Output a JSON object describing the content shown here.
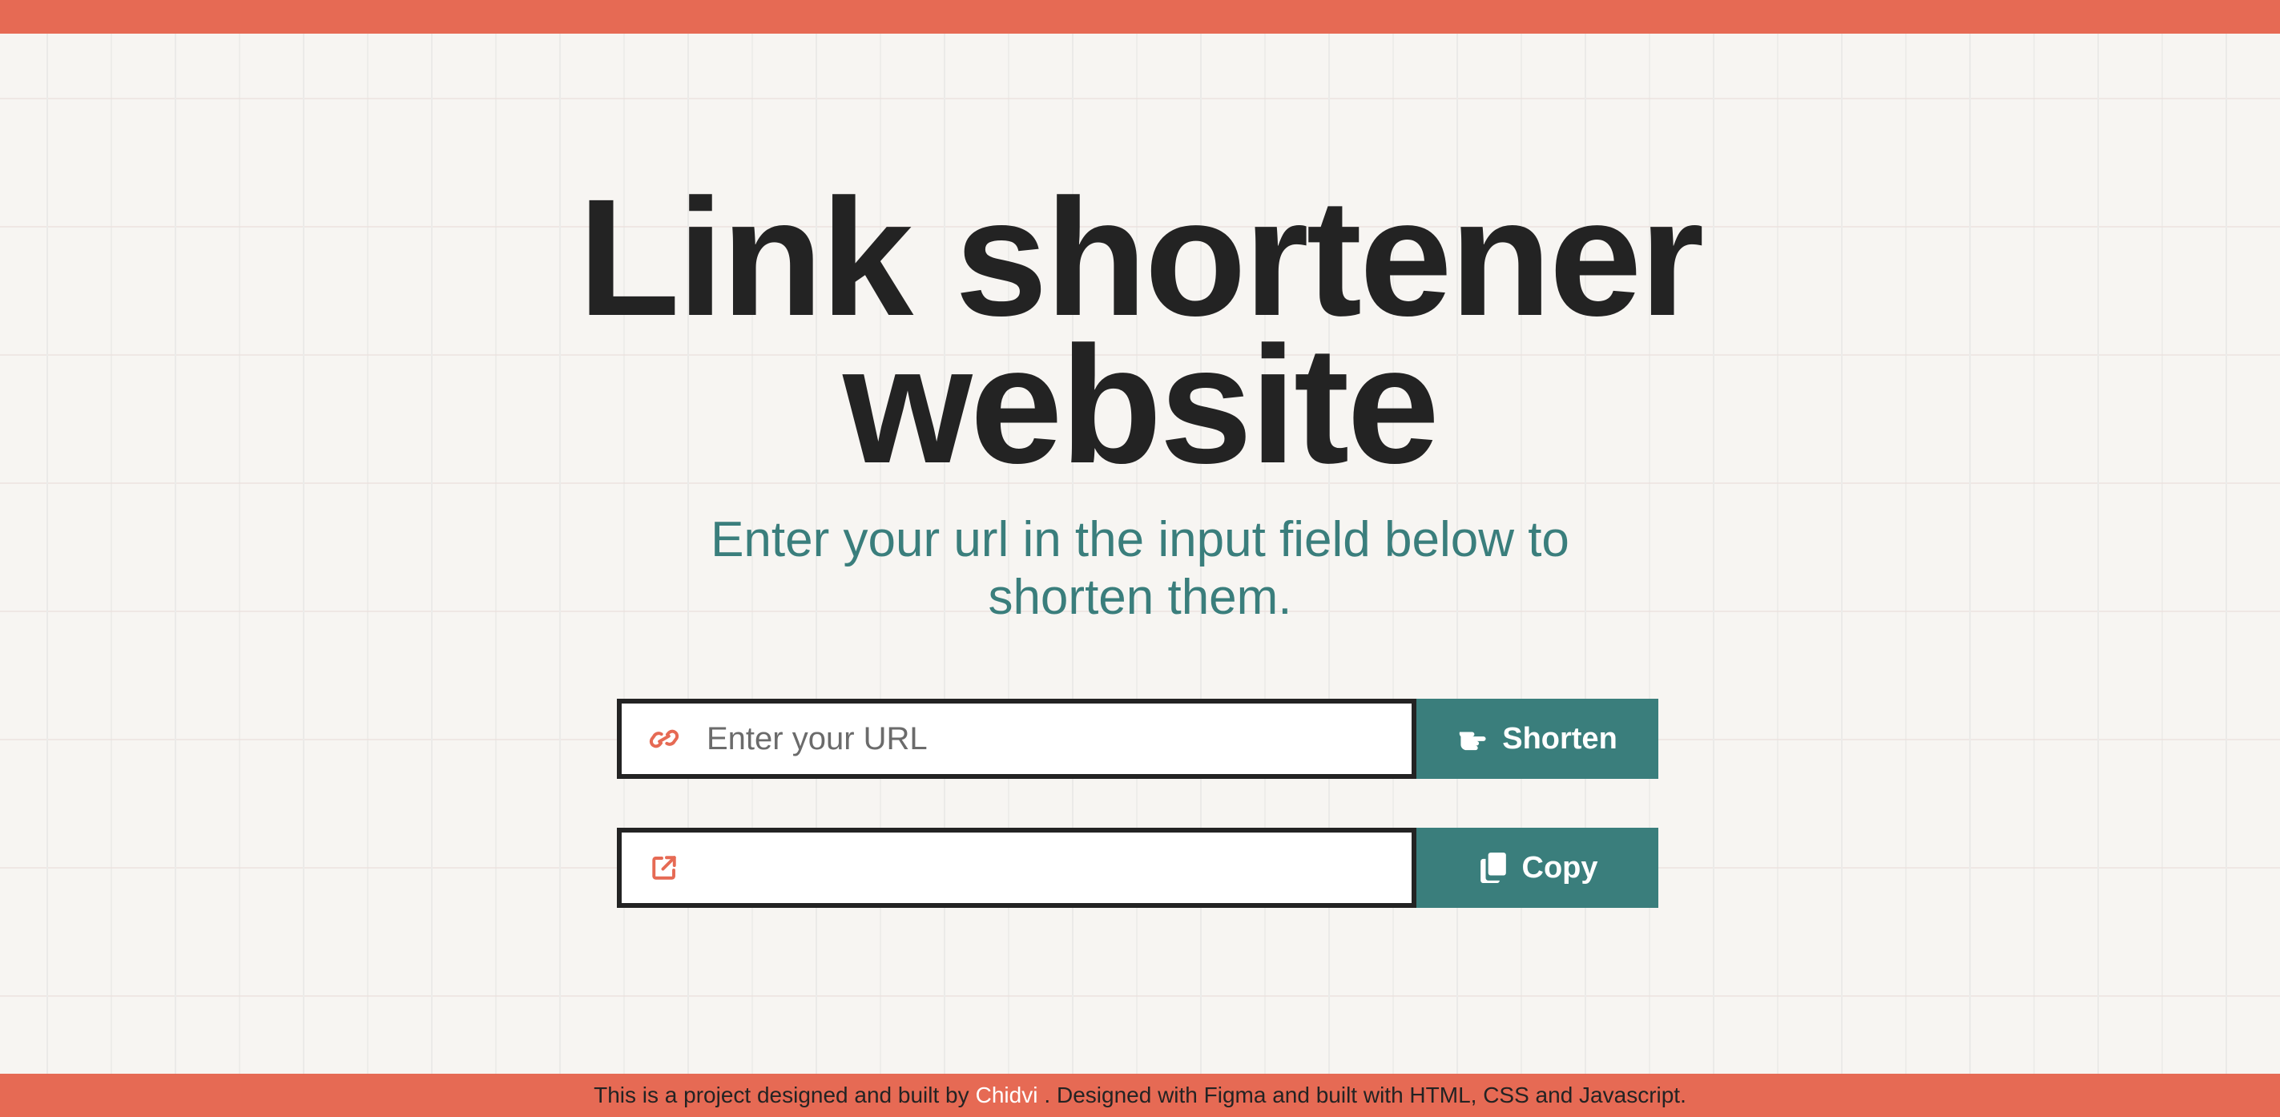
{
  "hero": {
    "title_line1": "Link shortener",
    "title_line2": "website",
    "subtitle": "Enter your url in the input field below to shorten them."
  },
  "shorten_form": {
    "input_placeholder": "Enter your URL",
    "input_value": "",
    "input_icon": "link-icon",
    "button_label": "Shorten",
    "button_icon": "hand-pointing-icon"
  },
  "result_form": {
    "output_value": "",
    "output_icon": "external-link-icon",
    "button_label": "Copy",
    "button_icon": "copy-icon"
  },
  "footer": {
    "text_before": "This is a project designed and built by",
    "author": "Chidvi",
    "text_after": ". Designed with Figma and built with HTML, CSS and Javascript."
  },
  "colors": {
    "accent_bar": "#e66a54",
    "button": "#3a7e7c",
    "heading": "#232323",
    "subtitle": "#3a7e7c",
    "background": "#f7f5f2"
  }
}
